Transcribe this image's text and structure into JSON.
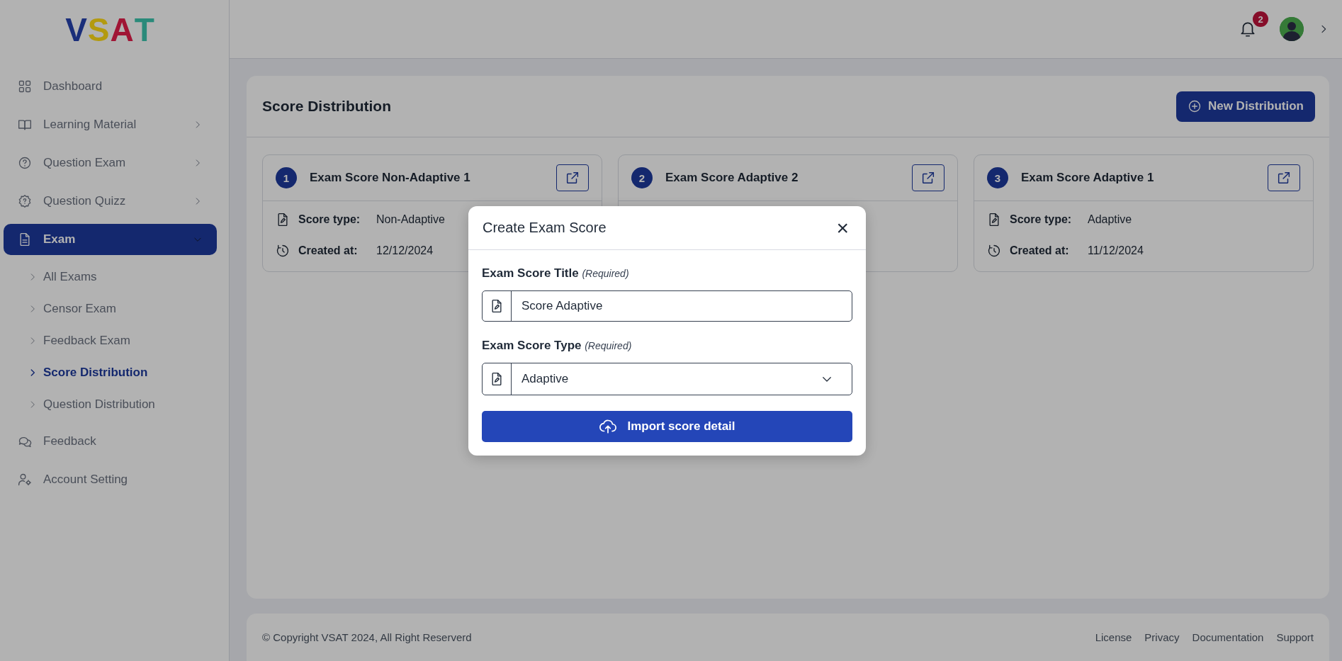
{
  "logo": {
    "letters": [
      {
        "text": "V",
        "color": "#1a2e7a"
      },
      {
        "text": "S",
        "color": "#b39a10"
      },
      {
        "text": "A",
        "color": "#a01535"
      },
      {
        "text": "T",
        "color": "#2a8a7a"
      }
    ]
  },
  "sidebar": {
    "items": [
      {
        "label": "Dashboard",
        "selected": false
      },
      {
        "label": "Learning Material",
        "selected": false,
        "expanded": false
      },
      {
        "label": "Question Exam",
        "selected": false,
        "expanded": false
      },
      {
        "label": "Question Quizz",
        "selected": false,
        "expanded": false
      },
      {
        "label": "Exam",
        "selected": true,
        "expanded": true,
        "children": [
          {
            "label": "All Exams",
            "selected": false
          },
          {
            "label": "Censor Exam",
            "selected": false
          },
          {
            "label": "Feedback Exam",
            "selected": false
          },
          {
            "label": "Score Distribution",
            "selected": true
          },
          {
            "label": "Question Distribution",
            "selected": false
          }
        ]
      },
      {
        "label": "Feedback",
        "selected": false
      },
      {
        "label": "Account Setting",
        "selected": false
      }
    ]
  },
  "header": {
    "notification_count": "2"
  },
  "panel": {
    "title": "Score Distribution",
    "new_button": "New Distribution",
    "cards": [
      {
        "number": "1",
        "title": "Exam Score Non-Adaptive 1",
        "fields": [
          {
            "label": "Score type:",
            "value": "Non-Adaptive"
          },
          {
            "label": "Created at:",
            "value": "12/12/2024"
          }
        ]
      },
      {
        "number": "2",
        "title": "Exam Score Adaptive 2"
      },
      {
        "number": "3",
        "title": "Exam Score Adaptive 1",
        "fields": [
          {
            "label": "Score type:",
            "value": "Adaptive"
          },
          {
            "label": "Created at:",
            "value": "11/12/2024"
          }
        ]
      }
    ]
  },
  "modal": {
    "title": "Create Exam Score",
    "close": "×",
    "fields": [
      {
        "kind": "text",
        "label": "Exam Score Title",
        "hint": "(Required)",
        "value": "Score Adaptive"
      },
      {
        "kind": "select",
        "label": "Exam Score Type",
        "hint": "(Required)",
        "value": "Adaptive"
      }
    ],
    "submit": "Import score detail"
  },
  "footer": {
    "copyright": "© Copyright VSAT 2024, All Right Reserverd",
    "links": [
      "License",
      "Privacy",
      "Documentation",
      "Support"
    ]
  }
}
